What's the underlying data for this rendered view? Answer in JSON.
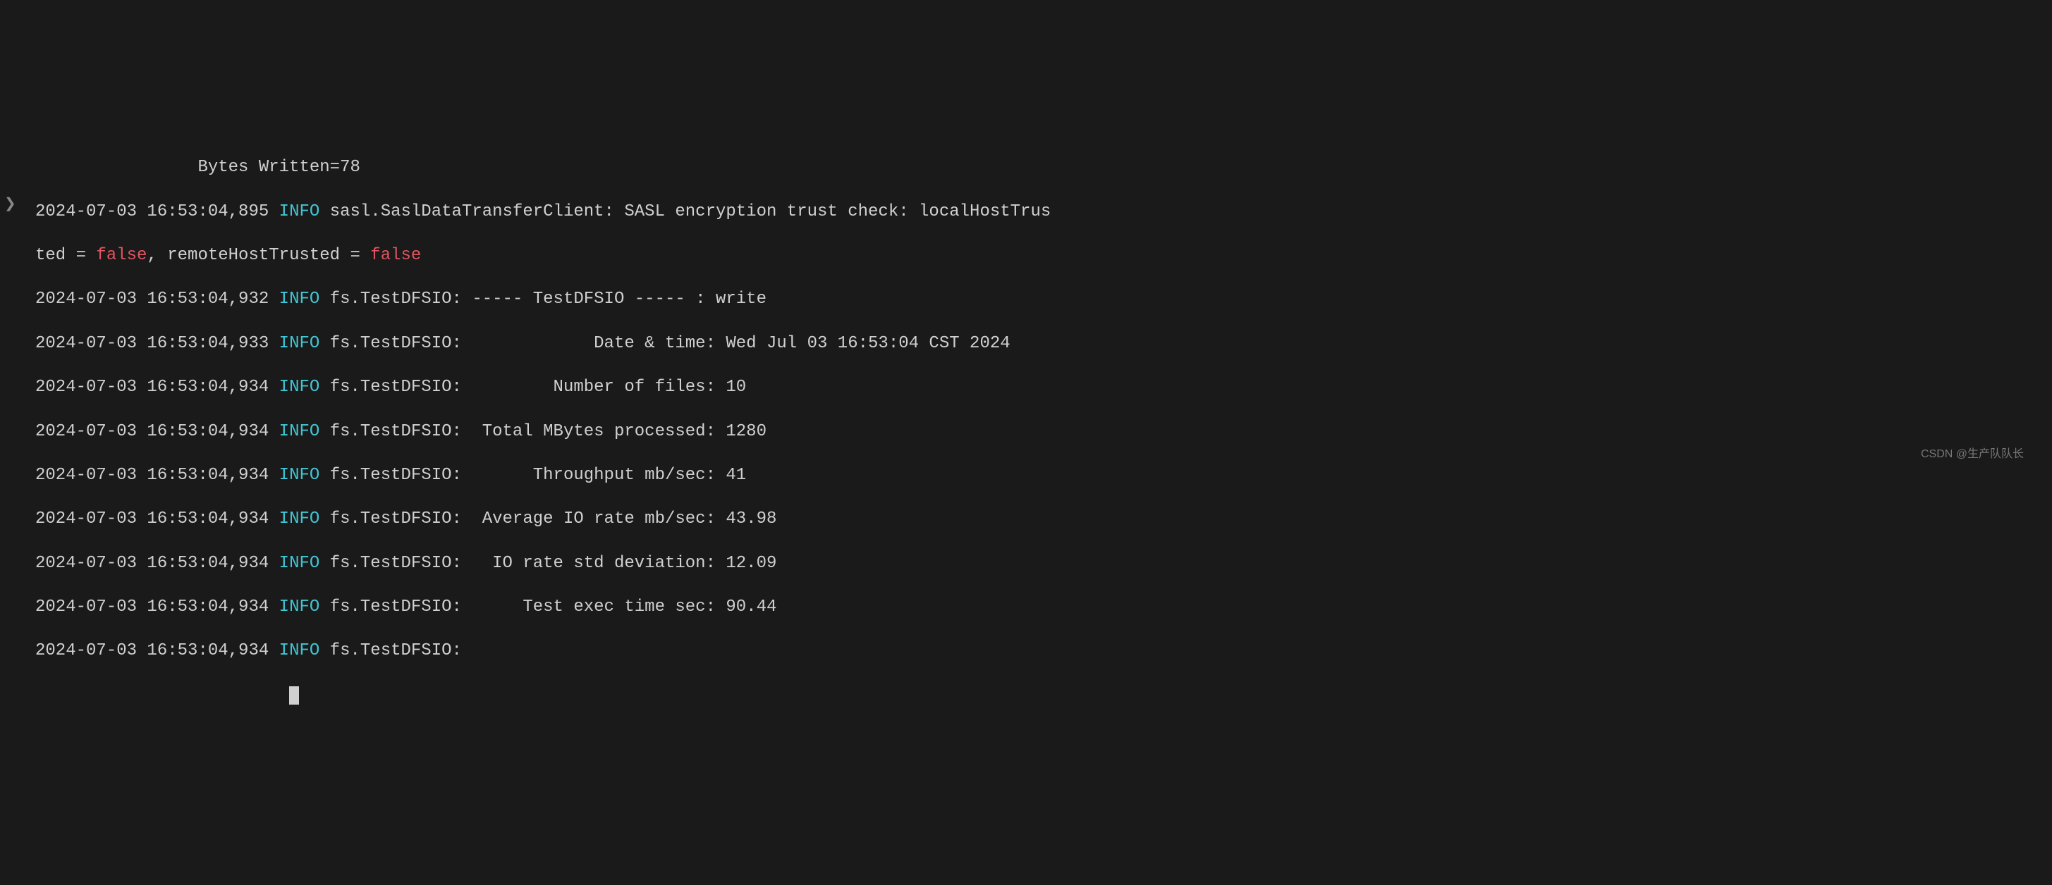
{
  "lines": {
    "l0_prefix": "                Bytes Written=78",
    "l1_ts": "2024-07-03 16:53:04,895",
    "l1_level": "INFO",
    "l1_msg": "sasl.SaslDataTransferClient: SASL encryption trust check: localHostTrus",
    "l2a": "ted = ",
    "l2_false1": "false",
    "l2b": ", remoteHostTrusted = ",
    "l2_false2": "false",
    "l3_ts": "2024-07-03 16:53:04,932",
    "l3_level": "INFO",
    "l3_msg": "fs.TestDFSIO: ----- TestDFSIO ----- : write",
    "l4_ts": "2024-07-03 16:53:04,933",
    "l4_level": "INFO",
    "l4_msg": "fs.TestDFSIO:             Date & time: Wed Jul 03 16:53:04 CST 2024",
    "l5_ts": "2024-07-03 16:53:04,934",
    "l5_level": "INFO",
    "l5_msg": "fs.TestDFSIO:         Number of files: 10",
    "l6_ts": "2024-07-03 16:53:04,934",
    "l6_level": "INFO",
    "l6_msg": "fs.TestDFSIO:  Total MBytes processed: 1280",
    "l7_ts": "2024-07-03 16:53:04,934",
    "l7_level": "INFO",
    "l7_msg": "fs.TestDFSIO:       Throughput mb/sec: 41",
    "l8_ts": "2024-07-03 16:53:04,934",
    "l8_level": "INFO",
    "l8_msg": "fs.TestDFSIO:  Average IO rate mb/sec: 43.98",
    "l9_ts": "2024-07-03 16:53:04,934",
    "l9_level": "INFO",
    "l9_msg": "fs.TestDFSIO:   IO rate std deviation: 12.09",
    "l10_ts": "2024-07-03 16:53:04,934",
    "l10_level": "INFO",
    "l10_msg": "fs.TestDFSIO:      Test exec time sec: 90.44",
    "l11_ts": "2024-07-03 16:53:04,934",
    "l11_level": "INFO",
    "l11_msg": "fs.TestDFSIO:"
  },
  "watermark": "CSDN @生产队队长",
  "chevron": "❯"
}
